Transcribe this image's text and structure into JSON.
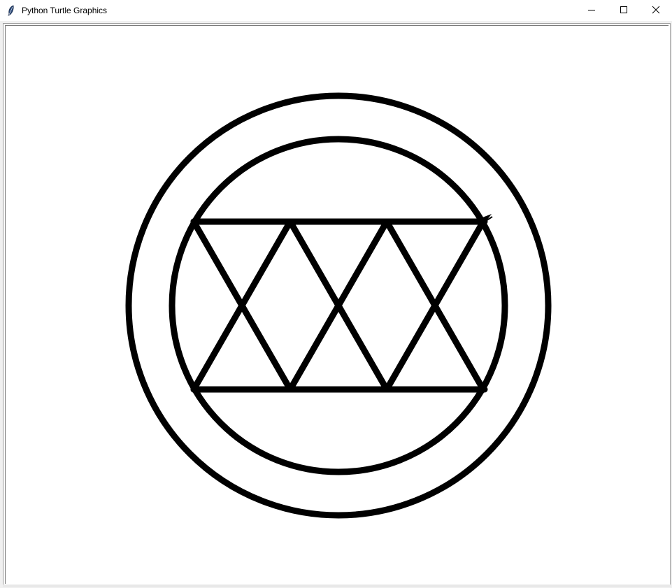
{
  "window": {
    "title": "Python Turtle Graphics",
    "icon": "feather-icon",
    "controls": {
      "minimize_icon": "minimize-icon",
      "maximize_icon": "maximize-icon",
      "close_icon": "close-icon"
    }
  },
  "canvas": {
    "background": "#ffffff",
    "pen_color": "#000000",
    "turtle_cursor": "classic-arrow-icon"
  },
  "colors": {
    "titlebar": "#ffffff",
    "frame": "#f0f0f0"
  }
}
